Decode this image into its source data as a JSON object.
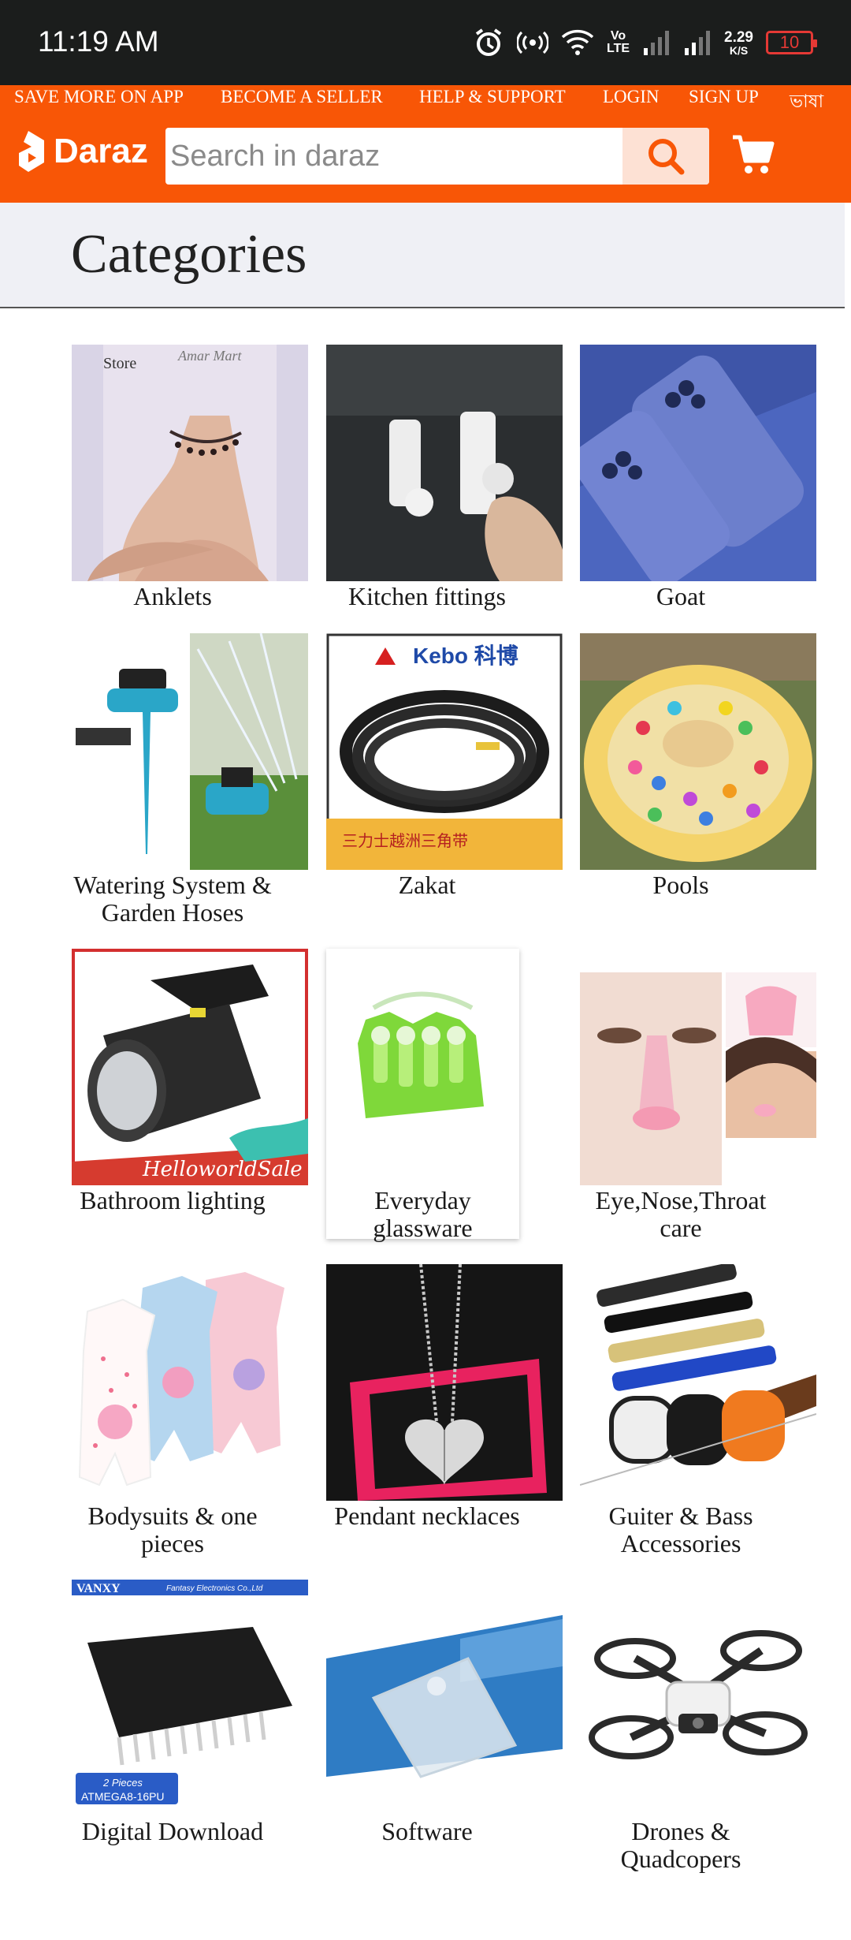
{
  "status_bar": {
    "time": "11:19 AM",
    "net_speed_value": "2.29",
    "net_speed_unit": "K/S",
    "volte_top": "Vo",
    "volte_bottom": "LTE",
    "battery": "10",
    "icons": [
      "alarm-icon",
      "hotspot-icon",
      "wifi-icon",
      "volte-icon",
      "signal-icon",
      "signal-icon",
      "battery-icon"
    ]
  },
  "header": {
    "links": [
      "SAVE MORE ON APP",
      "BECOME A SELLER",
      "HELP & SUPPORT",
      "LOGIN",
      "SIGN UP",
      "ভাষা"
    ],
    "brand": "Daraz",
    "search_placeholder": "Search in daraz",
    "accent_color": "#f85606"
  },
  "page": {
    "title": "Categories"
  },
  "categories": [
    {
      "label": "Anklets",
      "image_text": [
        "Store",
        "Amar Mart"
      ]
    },
    {
      "label": "Kitchen fittings"
    },
    {
      "label": "Goat"
    },
    {
      "label": "Watering System & Garden Hoses"
    },
    {
      "label": "Zakat",
      "image_text": [
        "Kebo 科博",
        "三力士越洲三角带"
      ]
    },
    {
      "label": "Pools"
    },
    {
      "label": "Bathroom lighting",
      "image_text": [
        "HelloworldSale"
      ]
    },
    {
      "label": "Everyday glassware"
    },
    {
      "label": "Eye,Nose,Throat care"
    },
    {
      "label": "Bodysuits & one pieces"
    },
    {
      "label": "Pendant necklaces"
    },
    {
      "label": "Guiter & Bass Accessories"
    },
    {
      "label": "Digital Download",
      "image_text": [
        "VANXY",
        "Fantasy Electronics Co.,Ltd",
        "2 Pieces",
        "ATMEGA8-16PU"
      ]
    },
    {
      "label": "Software"
    },
    {
      "label": "Drones & Quadcopers"
    }
  ]
}
